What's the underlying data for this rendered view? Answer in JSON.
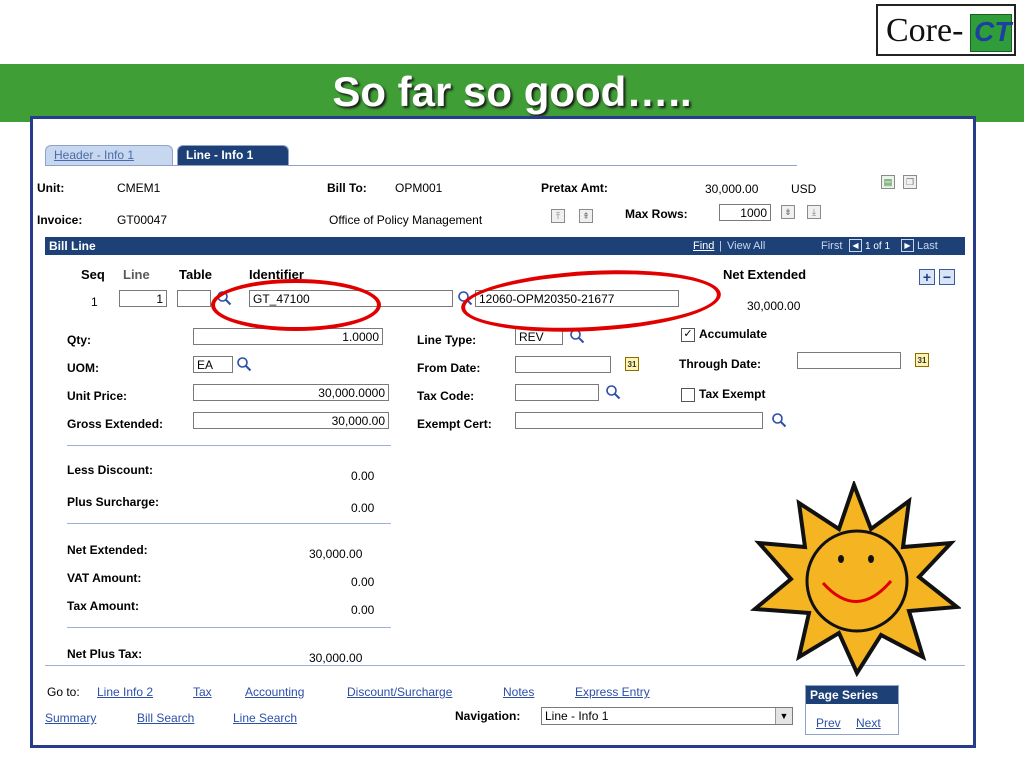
{
  "logo": {
    "text": "Core-",
    "accent": "CT"
  },
  "slide_title": "So far so good…..",
  "tabs": [
    {
      "label": "Header - Info 1",
      "active": false
    },
    {
      "label": "Line - Info 1",
      "active": true
    }
  ],
  "header": {
    "unit_label": "Unit:",
    "unit_value": "CMEM1",
    "invoice_label": "Invoice:",
    "invoice_value": "GT00047",
    "bill_to_label": "Bill To:",
    "bill_to_value": "OPM001",
    "bill_to_name": "Office of Policy Management",
    "pretax_label": "Pretax Amt:",
    "pretax_value": "30,000.00",
    "currency": "USD",
    "max_rows_label": "Max Rows:",
    "max_rows_value": "1000"
  },
  "bill_line": {
    "title": "Bill Line",
    "find": "Find",
    "view_all": "View All",
    "first": "First",
    "page_of": "1 of 1",
    "last": "Last",
    "col_seq": "Seq",
    "col_line": "Line",
    "col_table": "Table",
    "col_identifier": "Identifier",
    "col_net_extended": "Net Extended",
    "seq": "1",
    "line": "1",
    "table": "",
    "identifier": "GT_47100",
    "identifier2": "12060-OPM20350-21677",
    "net_extended": "30,000.00"
  },
  "fields": {
    "qty_label": "Qty:",
    "qty_value": "1.0000",
    "uom_label": "UOM:",
    "uom_value": "EA",
    "unit_price_label": "Unit Price:",
    "unit_price_value": "30,000.0000",
    "gross_label": "Gross Extended:",
    "gross_value": "30,000.00",
    "line_type_label": "Line Type:",
    "line_type_value": "REV",
    "from_date_label": "From Date:",
    "from_date_value": "",
    "tax_code_label": "Tax Code:",
    "tax_code_value": "",
    "exempt_cert_label": "Exempt Cert:",
    "exempt_cert_value": "",
    "accumulate_label": "Accumulate",
    "accumulate_checked": true,
    "through_date_label": "Through Date:",
    "through_date_value": "",
    "tax_exempt_label": "Tax Exempt",
    "tax_exempt_checked": false
  },
  "totals": {
    "less_discount_label": "Less Discount:",
    "less_discount_value": "0.00",
    "plus_surcharge_label": "Plus Surcharge:",
    "plus_surcharge_value": "0.00",
    "net_extended_label": "Net Extended:",
    "net_extended_value": "30,000.00",
    "vat_label": "VAT Amount:",
    "vat_value": "0.00",
    "tax_amount_label": "Tax Amount:",
    "tax_amount_value": "0.00",
    "net_plus_tax_label": "Net Plus Tax:",
    "net_plus_tax_value": "30,000.00"
  },
  "footer": {
    "goto_label": "Go to:",
    "links_row1": [
      "Line Info 2",
      "Tax",
      "Accounting",
      "Discount/Surcharge",
      "Notes",
      "Express Entry"
    ],
    "links_row2": [
      "Summary",
      "Bill Search",
      "Line Search"
    ],
    "navigation_label": "Navigation:",
    "navigation_value": "Line - Info 1",
    "page_series_label": "Page Series",
    "prev": "Prev",
    "next": "Next"
  },
  "colors": {
    "band": "#3f9e35",
    "frame": "#273c8a",
    "header_bar": "#1d4177",
    "highlight": "#e10000",
    "sun": "#f5b523"
  }
}
